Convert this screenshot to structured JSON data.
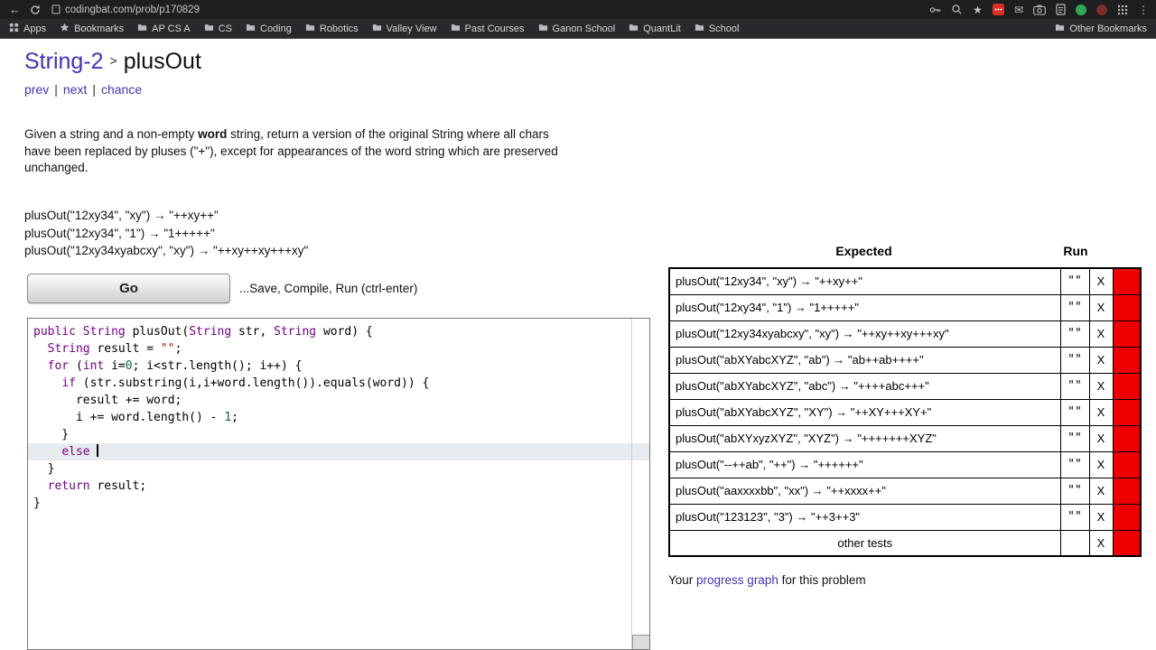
{
  "colors": {
    "fail_red": "#ee0000",
    "link_purple": "#4433bb",
    "keyword": "#770088",
    "number": "#116644",
    "string": "#aa1111"
  },
  "browser": {
    "url": "codingbat.com/prob/p170829",
    "bookmarks_bar": {
      "items": [
        {
          "label": "Apps",
          "icon": "grid"
        },
        {
          "label": "Bookmarks",
          "icon": "star"
        },
        {
          "label": "AP CS A",
          "icon": "folder"
        },
        {
          "label": "CS",
          "icon": "folder"
        },
        {
          "label": "Coding",
          "icon": "folder"
        },
        {
          "label": "Robotics",
          "icon": "folder"
        },
        {
          "label": "Valley View",
          "icon": "folder"
        },
        {
          "label": "Past Courses",
          "icon": "folder"
        },
        {
          "label": "Ganon School",
          "icon": "folder"
        },
        {
          "label": "QuantLit",
          "icon": "folder"
        },
        {
          "label": "School",
          "icon": "folder"
        }
      ],
      "other": {
        "label": "Other Bookmarks",
        "icon": "folder"
      }
    }
  },
  "header": {
    "section": "String-2",
    "separator": ">",
    "title": "plusOut",
    "nav_links": [
      "prev",
      "next",
      "chance"
    ],
    "nav_separator": "|"
  },
  "problem": {
    "description_pre": "Given a string and a non-empty ",
    "description_bold": "word",
    "description_post": " string, return a version of the original String where all chars have been replaced by pluses (\"+\"), except for appearances of the word string which are preserved unchanged.",
    "examples": [
      "plusOut(\"12xy34\", \"xy\") → \"++xy++\"",
      "plusOut(\"12xy34\", \"1\") → \"1+++++\"",
      "plusOut(\"12xy34xyabcxy\", \"xy\") → \"++xy++xy+++xy\""
    ]
  },
  "controls": {
    "go_label": "Go",
    "go_hint": "...Save, Compile, Run (ctrl-enter)"
  },
  "editor": {
    "active_line": 7,
    "cursor_line": 7,
    "lines": [
      [
        [
          "kw",
          "public"
        ],
        [
          "pl",
          " "
        ],
        [
          "kw",
          "String"
        ],
        [
          "pl",
          " plusOut("
        ],
        [
          "kw",
          "String"
        ],
        [
          "pl",
          " str, "
        ],
        [
          "kw",
          "String"
        ],
        [
          "pl",
          " word) {"
        ]
      ],
      [
        [
          "pl",
          "  "
        ],
        [
          "kw",
          "String"
        ],
        [
          "pl",
          " result = "
        ],
        [
          "str",
          "\"\""
        ],
        [
          "pl",
          ";"
        ]
      ],
      [
        [
          "pl",
          "  "
        ],
        [
          "kw",
          "for"
        ],
        [
          "pl",
          " ("
        ],
        [
          "kw",
          "int"
        ],
        [
          "pl",
          " i="
        ],
        [
          "num",
          "0"
        ],
        [
          "pl",
          "; i<str.length(); i++) {"
        ]
      ],
      [
        [
          "pl",
          "    "
        ],
        [
          "kw",
          "if"
        ],
        [
          "pl",
          " (str.substring(i,i+word.length()).equals(word)) {"
        ]
      ],
      [
        [
          "pl",
          "      result += word;"
        ]
      ],
      [
        [
          "pl",
          "      i += word.length() - "
        ],
        [
          "num",
          "1"
        ],
        [
          "pl",
          ";"
        ]
      ],
      [
        [
          "pl",
          "    }"
        ]
      ],
      [
        [
          "pl",
          "    "
        ],
        [
          "kw",
          "else"
        ],
        [
          "pl",
          " "
        ]
      ],
      [
        [
          "pl",
          "  }"
        ]
      ],
      [
        [
          "pl",
          "  "
        ],
        [
          "kw",
          "return"
        ],
        [
          "pl",
          " result;"
        ]
      ],
      [
        [
          "pl",
          "}"
        ]
      ]
    ]
  },
  "results": {
    "expected_header": "Expected",
    "run_header": "Run",
    "rows": [
      {
        "expected": "plusOut(\"12xy34\", \"xy\") → \"++xy++\"",
        "run": "\"\"",
        "status": "X"
      },
      {
        "expected": "plusOut(\"12xy34\", \"1\") → \"1+++++\"",
        "run": "\"\"",
        "status": "X"
      },
      {
        "expected": "plusOut(\"12xy34xyabcxy\", \"xy\") → \"++xy++xy+++xy\"",
        "run": "\"\"",
        "status": "X"
      },
      {
        "expected": "plusOut(\"abXYabcXYZ\", \"ab\") → \"ab++ab++++\"",
        "run": "\"\"",
        "status": "X"
      },
      {
        "expected": "plusOut(\"abXYabcXYZ\", \"abc\") → \"++++abc+++\"",
        "run": "\"\"",
        "status": "X"
      },
      {
        "expected": "plusOut(\"abXYabcXYZ\", \"XY\") → \"++XY+++XY+\"",
        "run": "\"\"",
        "status": "X"
      },
      {
        "expected": "plusOut(\"abXYxyzXYZ\", \"XYZ\") → \"+++++++XYZ\"",
        "run": "\"\"",
        "status": "X"
      },
      {
        "expected": "plusOut(\"--++ab\", \"++\") → \"++++++\"",
        "run": "\"\"",
        "status": "X"
      },
      {
        "expected": "plusOut(\"aaxxxxbb\", \"xx\") → \"++xxxx++\"",
        "run": "\"\"",
        "status": "X"
      },
      {
        "expected": "plusOut(\"123123\", \"3\") → \"++3++3\"",
        "run": "\"\"",
        "status": "X"
      },
      {
        "expected": "other tests",
        "run": "",
        "status": "X",
        "center": true
      }
    ]
  },
  "footer": {
    "pre": "Your ",
    "link": "progress graph",
    "post": " for this problem"
  }
}
